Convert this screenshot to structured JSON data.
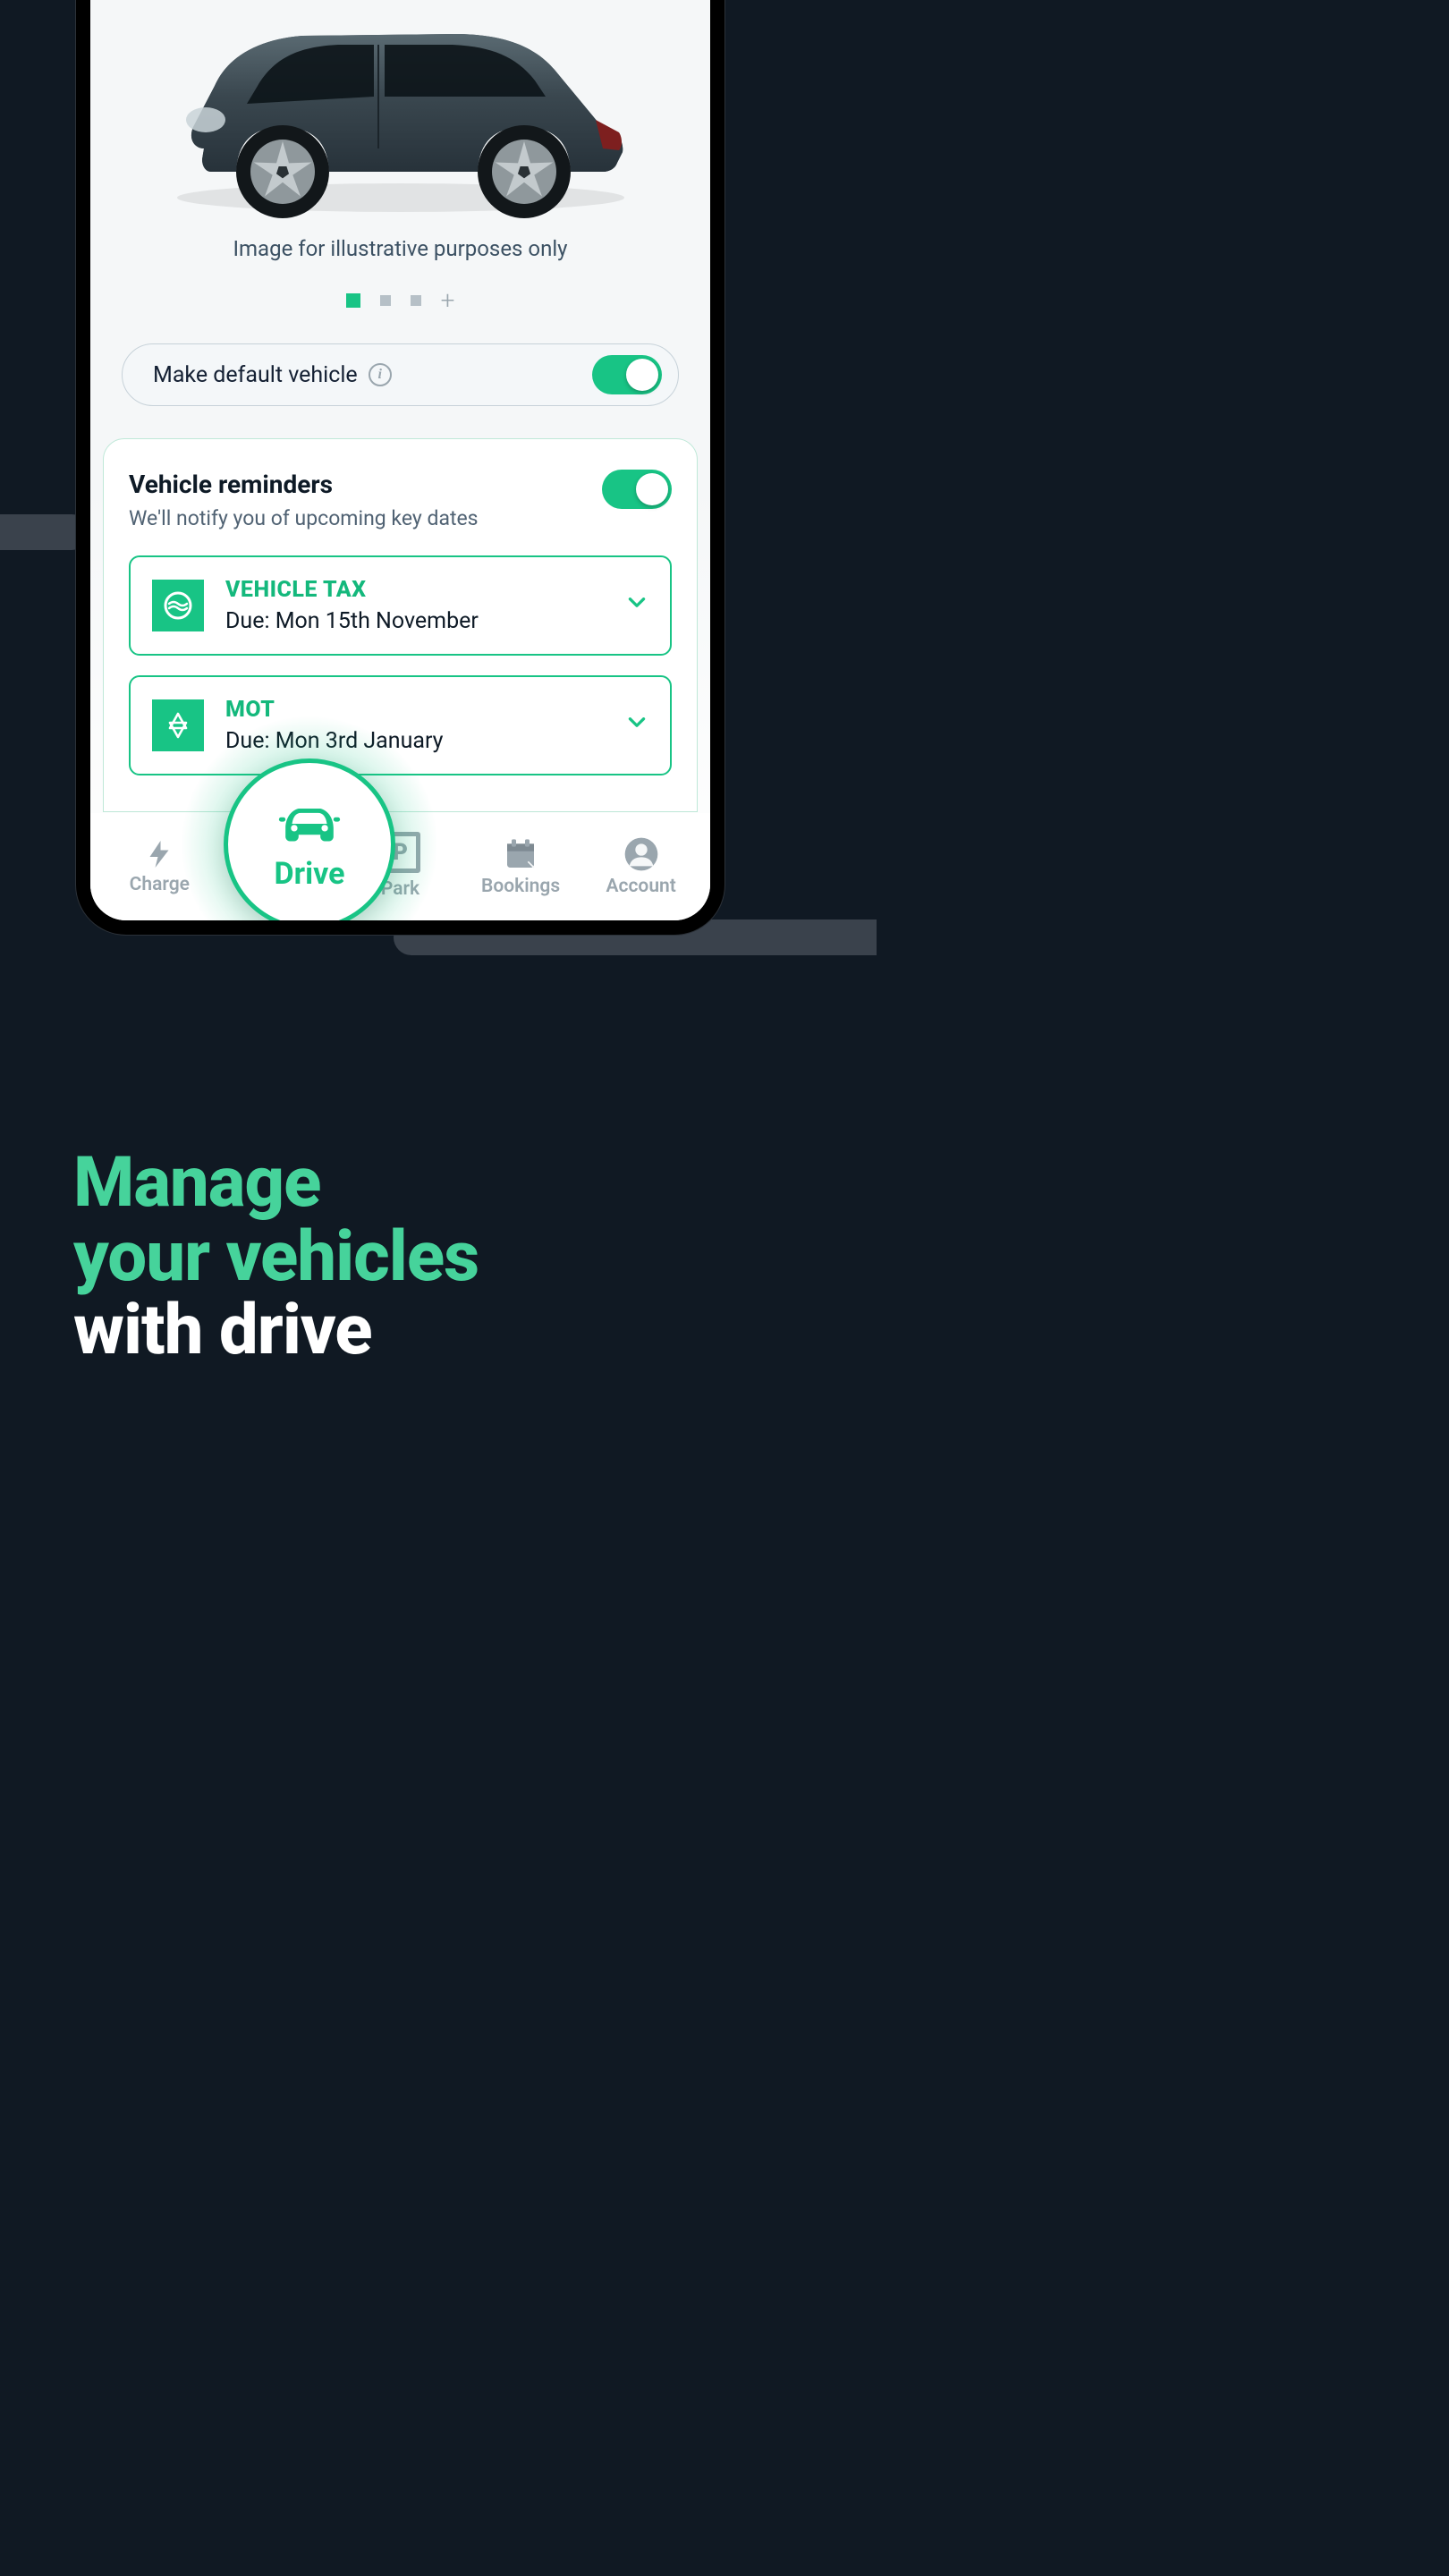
{
  "vehicle": {
    "image_caption": "Image for illustrative purposes only",
    "carousel": {
      "active_index": 0,
      "count": 3
    },
    "default_toggle": {
      "label": "Make default vehicle",
      "on": true
    }
  },
  "reminders_card": {
    "title": "Vehicle reminders",
    "subtitle": "We'll notify you of upcoming key dates",
    "toggle_on": true,
    "items": [
      {
        "icon": "tax-disc-icon",
        "label": "VEHICLE TAX",
        "due": "Due: Mon 15th November"
      },
      {
        "icon": "mot-icon",
        "label": "MOT",
        "due": "Due: Mon 3rd January"
      }
    ]
  },
  "nav": {
    "items": [
      {
        "id": "charge",
        "label": "Charge",
        "icon": "bolt-icon"
      },
      {
        "id": "drive",
        "label": "Drive",
        "icon": "car-icon",
        "active": true
      },
      {
        "id": "park",
        "label": "Park",
        "icon": "parking-icon"
      },
      {
        "id": "bookings",
        "label": "Bookings",
        "icon": "calendar-icon"
      },
      {
        "id": "account",
        "label": "Account",
        "icon": "user-icon"
      }
    ]
  },
  "marketing": {
    "line1": "Manage",
    "line2": "your vehicles",
    "line3": "with drive"
  },
  "colors": {
    "accent": "#18c485",
    "bg": "#101923",
    "text_dark": "#0e1a26",
    "muted": "#9aa6ae"
  }
}
